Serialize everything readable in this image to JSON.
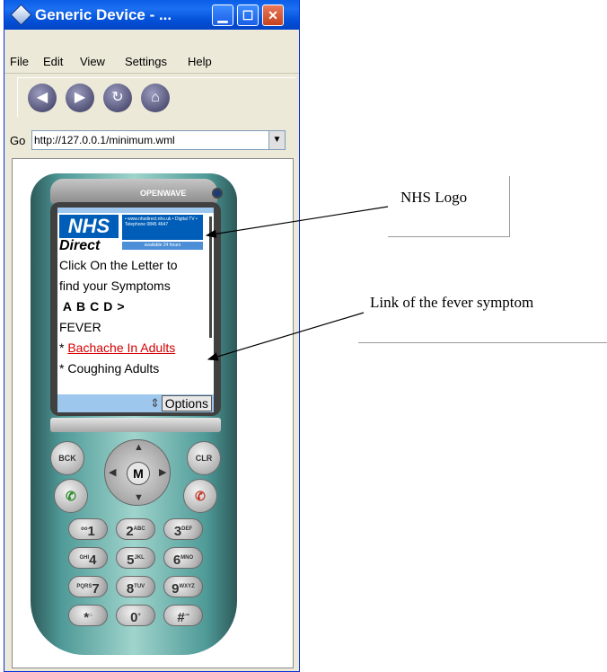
{
  "window": {
    "title": "Generic Device - ...",
    "controls": {
      "minimize": "▁",
      "maximize": "☐",
      "close": "✕"
    }
  },
  "menu": [
    "File",
    "Edit",
    "View",
    "Settings",
    "Help"
  ],
  "toolbar": {
    "back_icon": "back-arrow-icon",
    "forward_icon": "forward-arrow-icon",
    "refresh_icon": "refresh-icon",
    "home_icon": "home-icon"
  },
  "address": {
    "label": "Go",
    "url": "http://127.0.0.1/minimum.wml"
  },
  "phone": {
    "brand": "OPENWAVE",
    "screen": {
      "logo_main": "NHS",
      "logo_sub": "Direct",
      "logo_info": "• www.nhsdirect.nhs.uk • Digital TV • Telephone 0845 4647",
      "logo_hours": "available 24 hours",
      "line1": "Click On the Letter to",
      "line2": "find your Symptoms",
      "letters": [
        "A",
        "B",
        "C",
        "D",
        ">"
      ],
      "category": "FEVER",
      "bullet": "*",
      "link1": "Bachache In Adults",
      "line_cut": "* Coughing Adults",
      "softkey": "Options",
      "softkey_arrows": "⇕"
    },
    "keys": {
      "back": "BCK",
      "clear": "CLR",
      "center": "M",
      "numbers": [
        {
          "num": "1",
          "sub": "oo"
        },
        {
          "num": "2",
          "sub": "ABC"
        },
        {
          "num": "3",
          "sub": "DEF"
        },
        {
          "num": "4",
          "sub": "GHI"
        },
        {
          "num": "5",
          "sub": "JKL"
        },
        {
          "num": "6",
          "sub": "MNO"
        },
        {
          "num": "7",
          "sub": "PQRS"
        },
        {
          "num": "8",
          "sub": "TUV"
        },
        {
          "num": "9",
          "sub": "WXYZ"
        },
        {
          "num": "*",
          "sub": "⌂"
        },
        {
          "num": "0",
          "sub": "+"
        },
        {
          "num": "#",
          "sub": "⊸"
        }
      ]
    }
  },
  "annotations": {
    "logo_label": "NHS Logo",
    "link_label": "Link of the fever symptom"
  }
}
